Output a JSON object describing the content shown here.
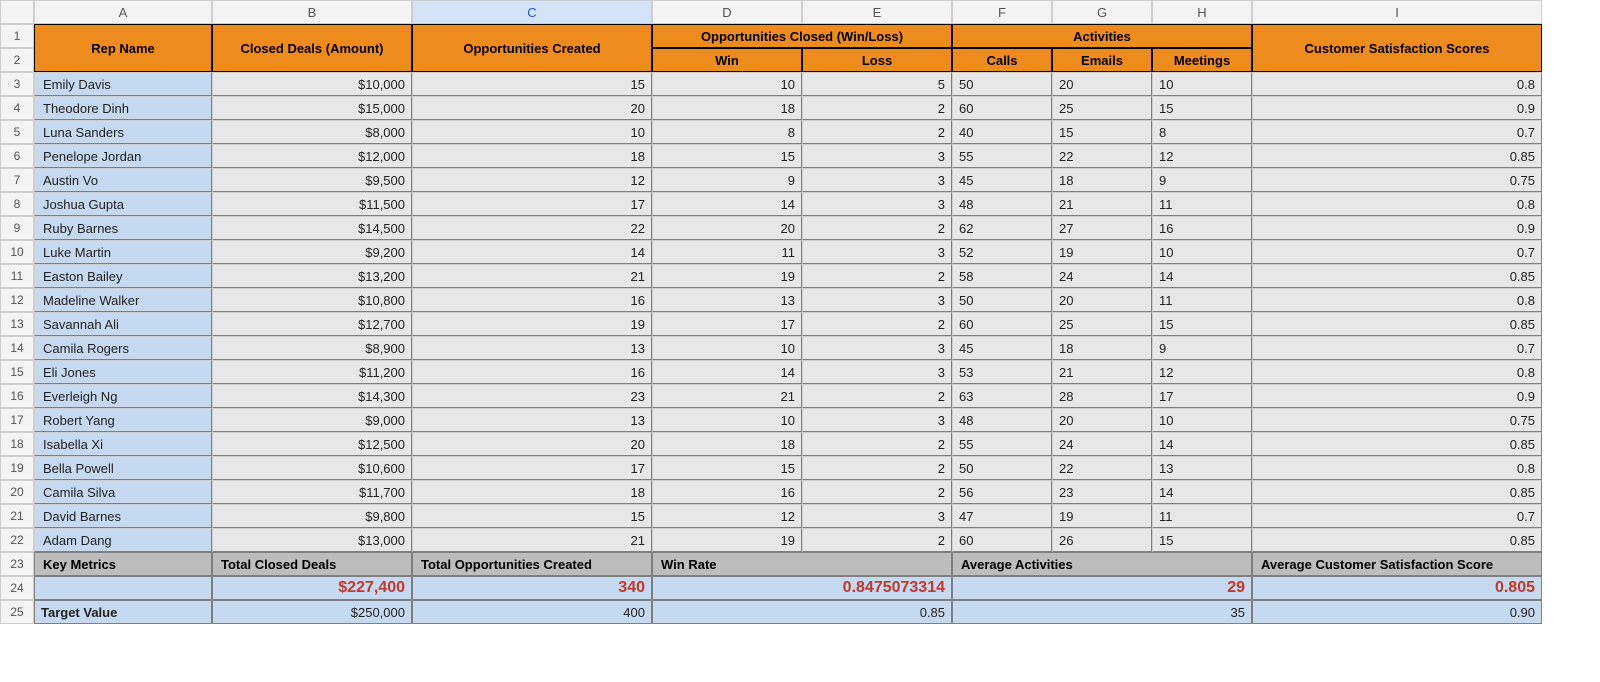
{
  "columns": [
    "A",
    "B",
    "C",
    "D",
    "E",
    "F",
    "G",
    "H",
    "I"
  ],
  "selected_column_index": 2,
  "row_numbers": [
    1,
    2,
    3,
    4,
    5,
    6,
    7,
    8,
    9,
    10,
    11,
    12,
    13,
    14,
    15,
    16,
    17,
    18,
    19,
    20,
    21,
    22,
    23,
    24,
    25
  ],
  "headers": {
    "rep_name": "Rep Name",
    "closed_deals": "Closed Deals (Amount)",
    "opps_created": "Opportunities Created",
    "opps_closed": "Opportunities Closed (Win/Loss)",
    "win": "Win",
    "loss": "Loss",
    "activities": "Activities",
    "calls": "Calls",
    "emails": "Emails",
    "meetings": "Meetings",
    "csat": "Customer Satisfaction Scores"
  },
  "reps": [
    {
      "name": "Emily Davis",
      "closed": "$10,000",
      "created": "15",
      "win": "10",
      "loss": "5",
      "calls": "50",
      "emails": "20",
      "meetings": "10",
      "csat": "0.8"
    },
    {
      "name": "Theodore Dinh",
      "closed": "$15,000",
      "created": "20",
      "win": "18",
      "loss": "2",
      "calls": "60",
      "emails": "25",
      "meetings": "15",
      "csat": "0.9"
    },
    {
      "name": "Luna Sanders",
      "closed": "$8,000",
      "created": "10",
      "win": "8",
      "loss": "2",
      "calls": "40",
      "emails": "15",
      "meetings": "8",
      "csat": "0.7"
    },
    {
      "name": "Penelope Jordan",
      "closed": "$12,000",
      "created": "18",
      "win": "15",
      "loss": "3",
      "calls": "55",
      "emails": "22",
      "meetings": "12",
      "csat": "0.85"
    },
    {
      "name": "Austin Vo",
      "closed": "$9,500",
      "created": "12",
      "win": "9",
      "loss": "3",
      "calls": "45",
      "emails": "18",
      "meetings": "9",
      "csat": "0.75"
    },
    {
      "name": "Joshua Gupta",
      "closed": "$11,500",
      "created": "17",
      "win": "14",
      "loss": "3",
      "calls": "48",
      "emails": "21",
      "meetings": "11",
      "csat": "0.8"
    },
    {
      "name": "Ruby Barnes",
      "closed": "$14,500",
      "created": "22",
      "win": "20",
      "loss": "2",
      "calls": "62",
      "emails": "27",
      "meetings": "16",
      "csat": "0.9"
    },
    {
      "name": "Luke Martin",
      "closed": "$9,200",
      "created": "14",
      "win": "11",
      "loss": "3",
      "calls": "52",
      "emails": "19",
      "meetings": "10",
      "csat": "0.7"
    },
    {
      "name": "Easton Bailey",
      "closed": "$13,200",
      "created": "21",
      "win": "19",
      "loss": "2",
      "calls": "58",
      "emails": "24",
      "meetings": "14",
      "csat": "0.85"
    },
    {
      "name": "Madeline Walker",
      "closed": "$10,800",
      "created": "16",
      "win": "13",
      "loss": "3",
      "calls": "50",
      "emails": "20",
      "meetings": "11",
      "csat": "0.8"
    },
    {
      "name": "Savannah Ali",
      "closed": "$12,700",
      "created": "19",
      "win": "17",
      "loss": "2",
      "calls": "60",
      "emails": "25",
      "meetings": "15",
      "csat": "0.85"
    },
    {
      "name": "Camila Rogers",
      "closed": "$8,900",
      "created": "13",
      "win": "10",
      "loss": "3",
      "calls": "45",
      "emails": "18",
      "meetings": "9",
      "csat": "0.7"
    },
    {
      "name": "Eli Jones",
      "closed": "$11,200",
      "created": "16",
      "win": "14",
      "loss": "3",
      "calls": "53",
      "emails": "21",
      "meetings": "12",
      "csat": "0.8"
    },
    {
      "name": "Everleigh Ng",
      "closed": "$14,300",
      "created": "23",
      "win": "21",
      "loss": "2",
      "calls": "63",
      "emails": "28",
      "meetings": "17",
      "csat": "0.9"
    },
    {
      "name": "Robert Yang",
      "closed": "$9,000",
      "created": "13",
      "win": "10",
      "loss": "3",
      "calls": "48",
      "emails": "20",
      "meetings": "10",
      "csat": "0.75"
    },
    {
      "name": "Isabella Xi",
      "closed": "$12,500",
      "created": "20",
      "win": "18",
      "loss": "2",
      "calls": "55",
      "emails": "24",
      "meetings": "14",
      "csat": "0.85"
    },
    {
      "name": "Bella Powell",
      "closed": "$10,600",
      "created": "17",
      "win": "15",
      "loss": "2",
      "calls": "50",
      "emails": "22",
      "meetings": "13",
      "csat": "0.8"
    },
    {
      "name": "Camila Silva",
      "closed": "$11,700",
      "created": "18",
      "win": "16",
      "loss": "2",
      "calls": "56",
      "emails": "23",
      "meetings": "14",
      "csat": "0.85"
    },
    {
      "name": "David Barnes",
      "closed": "$9,800",
      "created": "15",
      "win": "12",
      "loss": "3",
      "calls": "47",
      "emails": "19",
      "meetings": "11",
      "csat": "0.7"
    },
    {
      "name": "Adam Dang",
      "closed": "$13,000",
      "created": "21",
      "win": "19",
      "loss": "2",
      "calls": "60",
      "emails": "26",
      "meetings": "15",
      "csat": "0.85"
    }
  ],
  "metrics": {
    "key_label": "Key Metrics",
    "total_closed_label": "Total Closed Deals",
    "total_opps_label": "Total Opportunities Created",
    "win_rate_label": "Win Rate",
    "avg_activities_label": "Average Activities",
    "avg_csat_label": "Average Customer Satisfaction Score",
    "total_closed_value": "$227,400",
    "total_opps_value": "340",
    "win_rate_value": "0.8475073314",
    "avg_activities_value": "29",
    "avg_csat_value": "0.805"
  },
  "target": {
    "label": "Target Value",
    "closed": "$250,000",
    "opps": "400",
    "win_rate": "0.85",
    "activities": "35",
    "csat": "0.90"
  }
}
